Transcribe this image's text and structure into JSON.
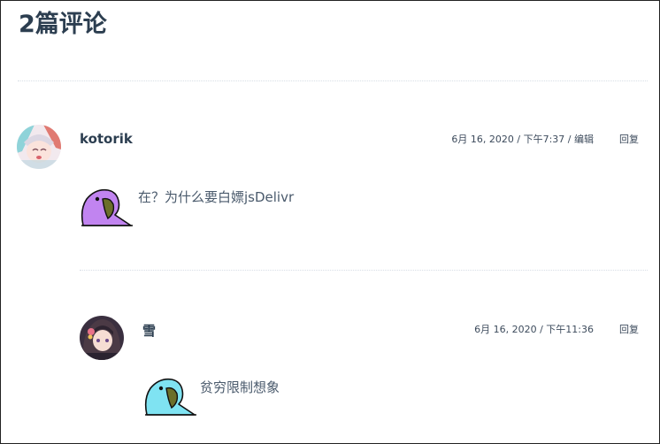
{
  "comments_section": {
    "title": "2篇评论"
  },
  "comments": [
    {
      "author": "kotorik",
      "date": "6月 16, 2020",
      "sep1": " / ",
      "time": "下午7:37",
      "sep2": " / ",
      "edit_label": "编辑",
      "reply_label": "回复",
      "text": "在？为什么要白嫖jsDelivr",
      "emoji": "purple-party-parrot",
      "emoji_color": "#c184f0"
    },
    {
      "author": "雪",
      "date": "6月 16, 2020",
      "sep1": " / ",
      "time": "下午11:36",
      "reply_label": "回复",
      "text": "贫穷限制想象",
      "emoji": "cyan-party-parrot",
      "emoji_color": "#7fe3f2"
    }
  ]
}
